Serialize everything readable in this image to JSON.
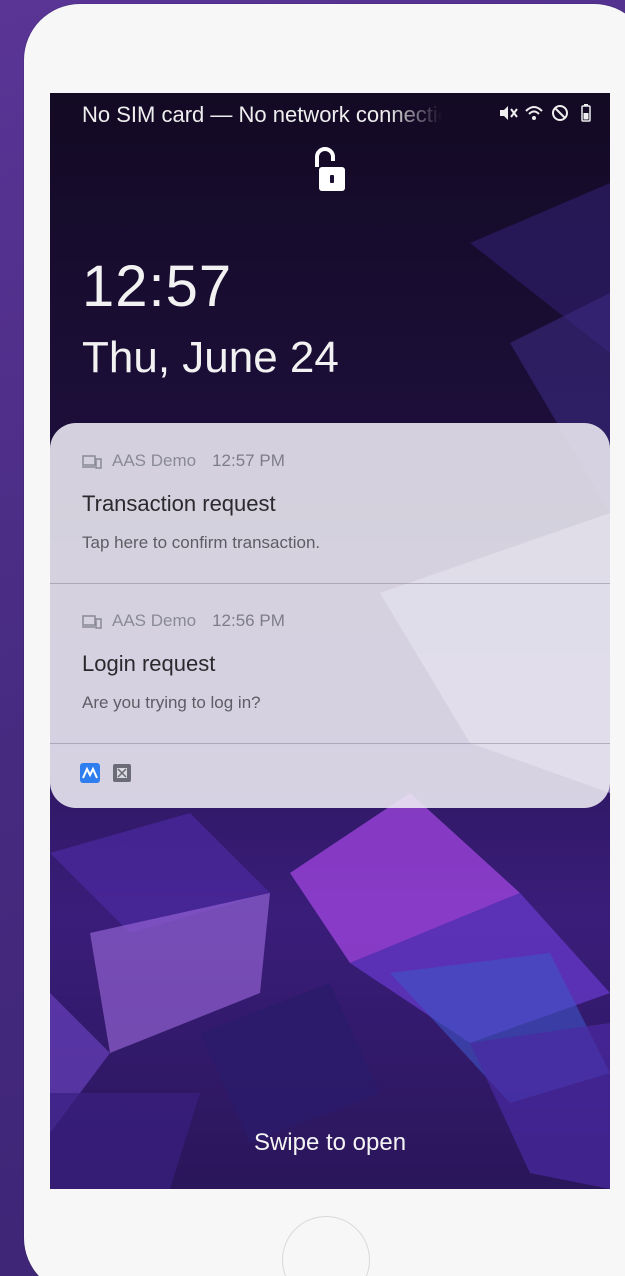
{
  "status_bar": {
    "text": "No SIM card — No network connection",
    "icons": [
      "mute-icon",
      "wifi-icon",
      "do-not-disturb-icon",
      "battery-icon"
    ]
  },
  "lock_screen": {
    "lock_icon": "unlocked-padlock-icon",
    "time": "12:57",
    "date": "Thu, June 24",
    "swipe_hint": "Swipe to open"
  },
  "notifications": [
    {
      "app": "AAS Demo",
      "time": "12:57 PM",
      "title": "Transaction request",
      "body": "Tap here to confirm transaction."
    },
    {
      "app": "AAS Demo",
      "time": "12:56 PM",
      "title": "Login request",
      "body": "Are you trying to log in?"
    }
  ],
  "notification_tray_apps": [
    "aas-demo-app-icon",
    "secure-app-icon"
  ],
  "colors": {
    "background": "#4b2d86",
    "panel": "#eeecf4",
    "wallpaper_dark": "#1a0f33",
    "wallpaper_accent": "#8a3bd8"
  }
}
